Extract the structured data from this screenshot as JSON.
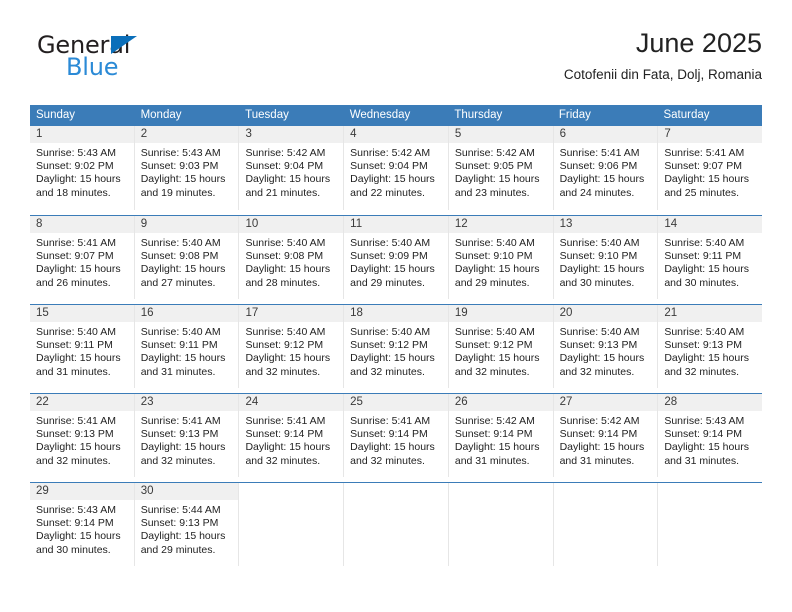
{
  "brand": {
    "word_general": "General",
    "word_blue": "Blue",
    "triangle_color": "#0b6fba",
    "blue_color": "#2b8ad6"
  },
  "header": {
    "title": "June 2025",
    "subtitle": "Cotofenii din Fata, Dolj, Romania"
  },
  "theme": {
    "header_bg": "#3b7cb8",
    "daynum_bg": "#f0f0f0",
    "row_rule": "#3b7cb8"
  },
  "weekdays": [
    "Sunday",
    "Monday",
    "Tuesday",
    "Wednesday",
    "Thursday",
    "Friday",
    "Saturday"
  ],
  "weeks": [
    [
      {
        "day": "1",
        "sunrise": "Sunrise: 5:43 AM",
        "sunset": "Sunset: 9:02 PM",
        "daylight": "Daylight: 15 hours and 18 minutes."
      },
      {
        "day": "2",
        "sunrise": "Sunrise: 5:43 AM",
        "sunset": "Sunset: 9:03 PM",
        "daylight": "Daylight: 15 hours and 19 minutes."
      },
      {
        "day": "3",
        "sunrise": "Sunrise: 5:42 AM",
        "sunset": "Sunset: 9:04 PM",
        "daylight": "Daylight: 15 hours and 21 minutes."
      },
      {
        "day": "4",
        "sunrise": "Sunrise: 5:42 AM",
        "sunset": "Sunset: 9:04 PM",
        "daylight": "Daylight: 15 hours and 22 minutes."
      },
      {
        "day": "5",
        "sunrise": "Sunrise: 5:42 AM",
        "sunset": "Sunset: 9:05 PM",
        "daylight": "Daylight: 15 hours and 23 minutes."
      },
      {
        "day": "6",
        "sunrise": "Sunrise: 5:41 AM",
        "sunset": "Sunset: 9:06 PM",
        "daylight": "Daylight: 15 hours and 24 minutes."
      },
      {
        "day": "7",
        "sunrise": "Sunrise: 5:41 AM",
        "sunset": "Sunset: 9:07 PM",
        "daylight": "Daylight: 15 hours and 25 minutes."
      }
    ],
    [
      {
        "day": "8",
        "sunrise": "Sunrise: 5:41 AM",
        "sunset": "Sunset: 9:07 PM",
        "daylight": "Daylight: 15 hours and 26 minutes."
      },
      {
        "day": "9",
        "sunrise": "Sunrise: 5:40 AM",
        "sunset": "Sunset: 9:08 PM",
        "daylight": "Daylight: 15 hours and 27 minutes."
      },
      {
        "day": "10",
        "sunrise": "Sunrise: 5:40 AM",
        "sunset": "Sunset: 9:08 PM",
        "daylight": "Daylight: 15 hours and 28 minutes."
      },
      {
        "day": "11",
        "sunrise": "Sunrise: 5:40 AM",
        "sunset": "Sunset: 9:09 PM",
        "daylight": "Daylight: 15 hours and 29 minutes."
      },
      {
        "day": "12",
        "sunrise": "Sunrise: 5:40 AM",
        "sunset": "Sunset: 9:10 PM",
        "daylight": "Daylight: 15 hours and 29 minutes."
      },
      {
        "day": "13",
        "sunrise": "Sunrise: 5:40 AM",
        "sunset": "Sunset: 9:10 PM",
        "daylight": "Daylight: 15 hours and 30 minutes."
      },
      {
        "day": "14",
        "sunrise": "Sunrise: 5:40 AM",
        "sunset": "Sunset: 9:11 PM",
        "daylight": "Daylight: 15 hours and 30 minutes."
      }
    ],
    [
      {
        "day": "15",
        "sunrise": "Sunrise: 5:40 AM",
        "sunset": "Sunset: 9:11 PM",
        "daylight": "Daylight: 15 hours and 31 minutes."
      },
      {
        "day": "16",
        "sunrise": "Sunrise: 5:40 AM",
        "sunset": "Sunset: 9:11 PM",
        "daylight": "Daylight: 15 hours and 31 minutes."
      },
      {
        "day": "17",
        "sunrise": "Sunrise: 5:40 AM",
        "sunset": "Sunset: 9:12 PM",
        "daylight": "Daylight: 15 hours and 32 minutes."
      },
      {
        "day": "18",
        "sunrise": "Sunrise: 5:40 AM",
        "sunset": "Sunset: 9:12 PM",
        "daylight": "Daylight: 15 hours and 32 minutes."
      },
      {
        "day": "19",
        "sunrise": "Sunrise: 5:40 AM",
        "sunset": "Sunset: 9:12 PM",
        "daylight": "Daylight: 15 hours and 32 minutes."
      },
      {
        "day": "20",
        "sunrise": "Sunrise: 5:40 AM",
        "sunset": "Sunset: 9:13 PM",
        "daylight": "Daylight: 15 hours and 32 minutes."
      },
      {
        "day": "21",
        "sunrise": "Sunrise: 5:40 AM",
        "sunset": "Sunset: 9:13 PM",
        "daylight": "Daylight: 15 hours and 32 minutes."
      }
    ],
    [
      {
        "day": "22",
        "sunrise": "Sunrise: 5:41 AM",
        "sunset": "Sunset: 9:13 PM",
        "daylight": "Daylight: 15 hours and 32 minutes."
      },
      {
        "day": "23",
        "sunrise": "Sunrise: 5:41 AM",
        "sunset": "Sunset: 9:13 PM",
        "daylight": "Daylight: 15 hours and 32 minutes."
      },
      {
        "day": "24",
        "sunrise": "Sunrise: 5:41 AM",
        "sunset": "Sunset: 9:14 PM",
        "daylight": "Daylight: 15 hours and 32 minutes."
      },
      {
        "day": "25",
        "sunrise": "Sunrise: 5:41 AM",
        "sunset": "Sunset: 9:14 PM",
        "daylight": "Daylight: 15 hours and 32 minutes."
      },
      {
        "day": "26",
        "sunrise": "Sunrise: 5:42 AM",
        "sunset": "Sunset: 9:14 PM",
        "daylight": "Daylight: 15 hours and 31 minutes."
      },
      {
        "day": "27",
        "sunrise": "Sunrise: 5:42 AM",
        "sunset": "Sunset: 9:14 PM",
        "daylight": "Daylight: 15 hours and 31 minutes."
      },
      {
        "day": "28",
        "sunrise": "Sunrise: 5:43 AM",
        "sunset": "Sunset: 9:14 PM",
        "daylight": "Daylight: 15 hours and 31 minutes."
      }
    ],
    [
      {
        "day": "29",
        "sunrise": "Sunrise: 5:43 AM",
        "sunset": "Sunset: 9:14 PM",
        "daylight": "Daylight: 15 hours and 30 minutes."
      },
      {
        "day": "30",
        "sunrise": "Sunrise: 5:44 AM",
        "sunset": "Sunset: 9:13 PM",
        "daylight": "Daylight: 15 hours and 29 minutes."
      },
      {
        "day": "",
        "sunrise": "",
        "sunset": "",
        "daylight": ""
      },
      {
        "day": "",
        "sunrise": "",
        "sunset": "",
        "daylight": ""
      },
      {
        "day": "",
        "sunrise": "",
        "sunset": "",
        "daylight": ""
      },
      {
        "day": "",
        "sunrise": "",
        "sunset": "",
        "daylight": ""
      },
      {
        "day": "",
        "sunrise": "",
        "sunset": "",
        "daylight": ""
      }
    ]
  ]
}
